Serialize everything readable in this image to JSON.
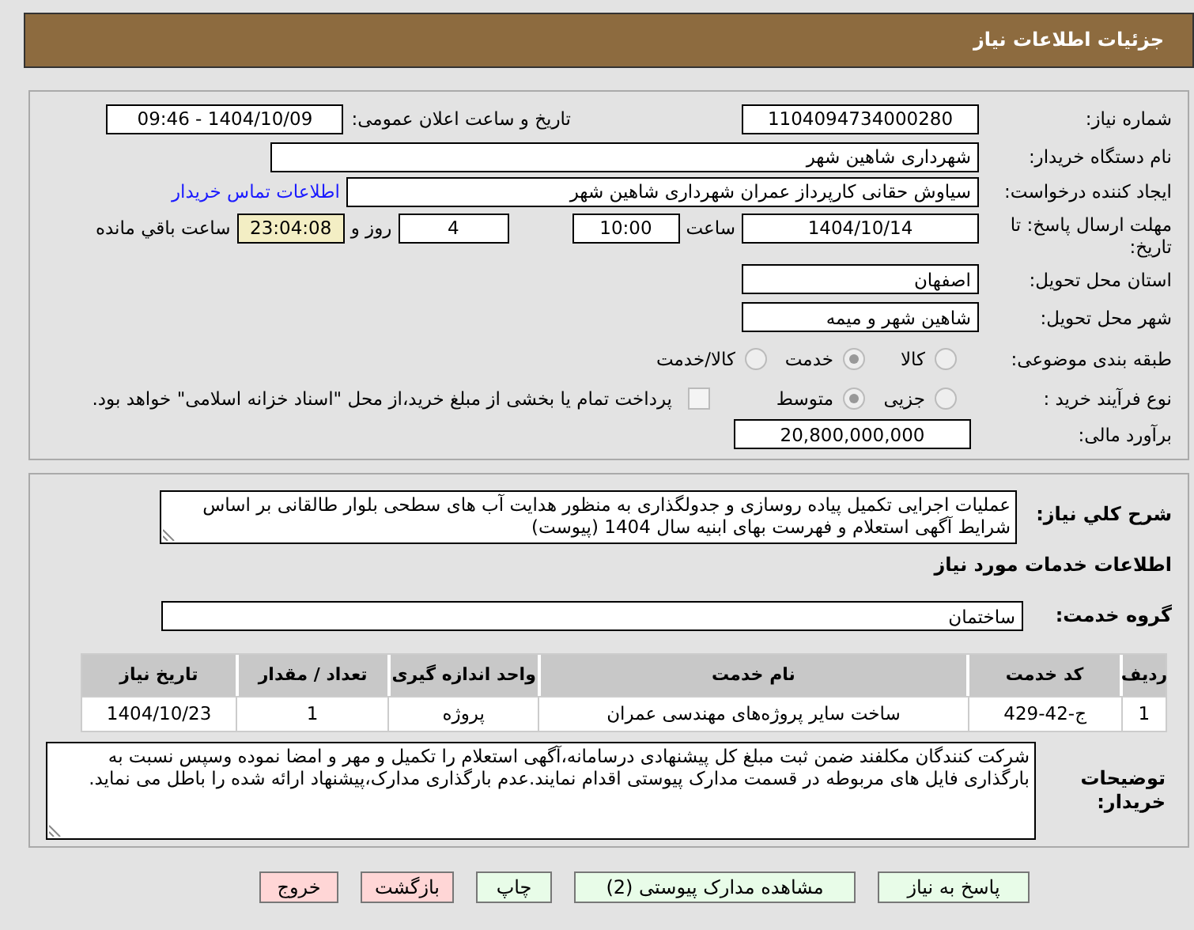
{
  "header": {
    "title": "جزئیات اطلاعات نیاز"
  },
  "need_number": {
    "label": "شماره نیاز:",
    "value": "1104094734000280"
  },
  "announce_date": {
    "label": "تاریخ و ساعت اعلان عمومی:",
    "value": "1404/10/09 - 09:46"
  },
  "buyer": {
    "label": "نام دستگاه خریدار:",
    "value": "شهرداری شاهین شهر"
  },
  "requester": {
    "label": "ایجاد کننده درخواست:",
    "value": "سیاوش حقانی کارپرداز عمران شهرداری شاهین شهر",
    "contact_link": "اطلاعات تماس خریدار"
  },
  "deadline": {
    "label": "مهلت ارسال پاسخ: تا تاریخ:",
    "date": "1404/10/14",
    "time_label": "ساعت",
    "time": "10:00",
    "days": "4",
    "days_label": "روز و",
    "remaining": "23:04:08",
    "remaining_label": "ساعت باقي مانده"
  },
  "province": {
    "label": "استان محل تحویل:",
    "value": "اصفهان"
  },
  "city": {
    "label": "شهر محل تحویل:",
    "value": "شاهین شهر و میمه"
  },
  "category": {
    "label": "طبقه بندی موضوعی:",
    "options": [
      {
        "label": "کالا",
        "selected": false
      },
      {
        "label": "خدمت",
        "selected": true
      },
      {
        "label": "کالا/خدمت",
        "selected": false
      }
    ]
  },
  "process": {
    "label": "نوع فرآیند خرید :",
    "options": [
      {
        "label": "جزیی",
        "selected": false
      },
      {
        "label": "متوسط",
        "selected": true
      }
    ],
    "treasury": {
      "checked": false,
      "text": "پرداخت تمام یا بخشی از مبلغ خرید،از محل \"اسناد خزانه اسلامی\" خواهد بود."
    }
  },
  "budget": {
    "label": "برآورد مالی:",
    "value": "20,800,000,000"
  },
  "description": {
    "label": "شرح کلي نیاز:",
    "value": "عملیات اجرایی تکمیل پیاده روسازی و جدولگذاری به منظور هدایت آب های سطحی بلوار طالقانی بر اساس شرایط آگهی استعلام و فهرست بهای ابنیه سال 1404 (پیوست)"
  },
  "services_heading": "اطلاعات خدمات مورد نیاز",
  "service_group": {
    "label": "گروه خدمت:",
    "value": "ساختمان"
  },
  "table": {
    "columns": [
      "ردیف",
      "کد خدمت",
      "نام خدمت",
      "واحد اندازه گیری",
      "تعداد / مقدار",
      "تاریخ نیاز"
    ],
    "rows": [
      [
        "1",
        "ج-42-429",
        "ساخت سایر پروژه‌های مهندسی عمران",
        "پروژه",
        "1",
        "1404/10/23"
      ]
    ]
  },
  "buyer_notes": {
    "label": "توضیحات خریدار:",
    "value": "شرکت کنندگان مکلفند ضمن ثبت مبلغ کل پیشنهادی درسامانه،آگهی استعلام را  تکمیل و مهر و امضا نموده وسپس نسبت به بارگذاری فایل های مربوطه در قسمت مدارک پیوستی اقدام نمایند.عدم بارگذاری مدارک،پیشنهاد ارائه شده را باطل می نماید."
  },
  "buttons": [
    {
      "label": "پاسخ به نیاز",
      "kind": "normal"
    },
    {
      "label": "مشاهده مدارک پیوستی (2)",
      "kind": "normal"
    },
    {
      "label": "چاپ",
      "kind": "normal"
    },
    {
      "label": "بازگشت",
      "kind": "alert"
    },
    {
      "label": "خروج",
      "kind": "alert"
    }
  ]
}
